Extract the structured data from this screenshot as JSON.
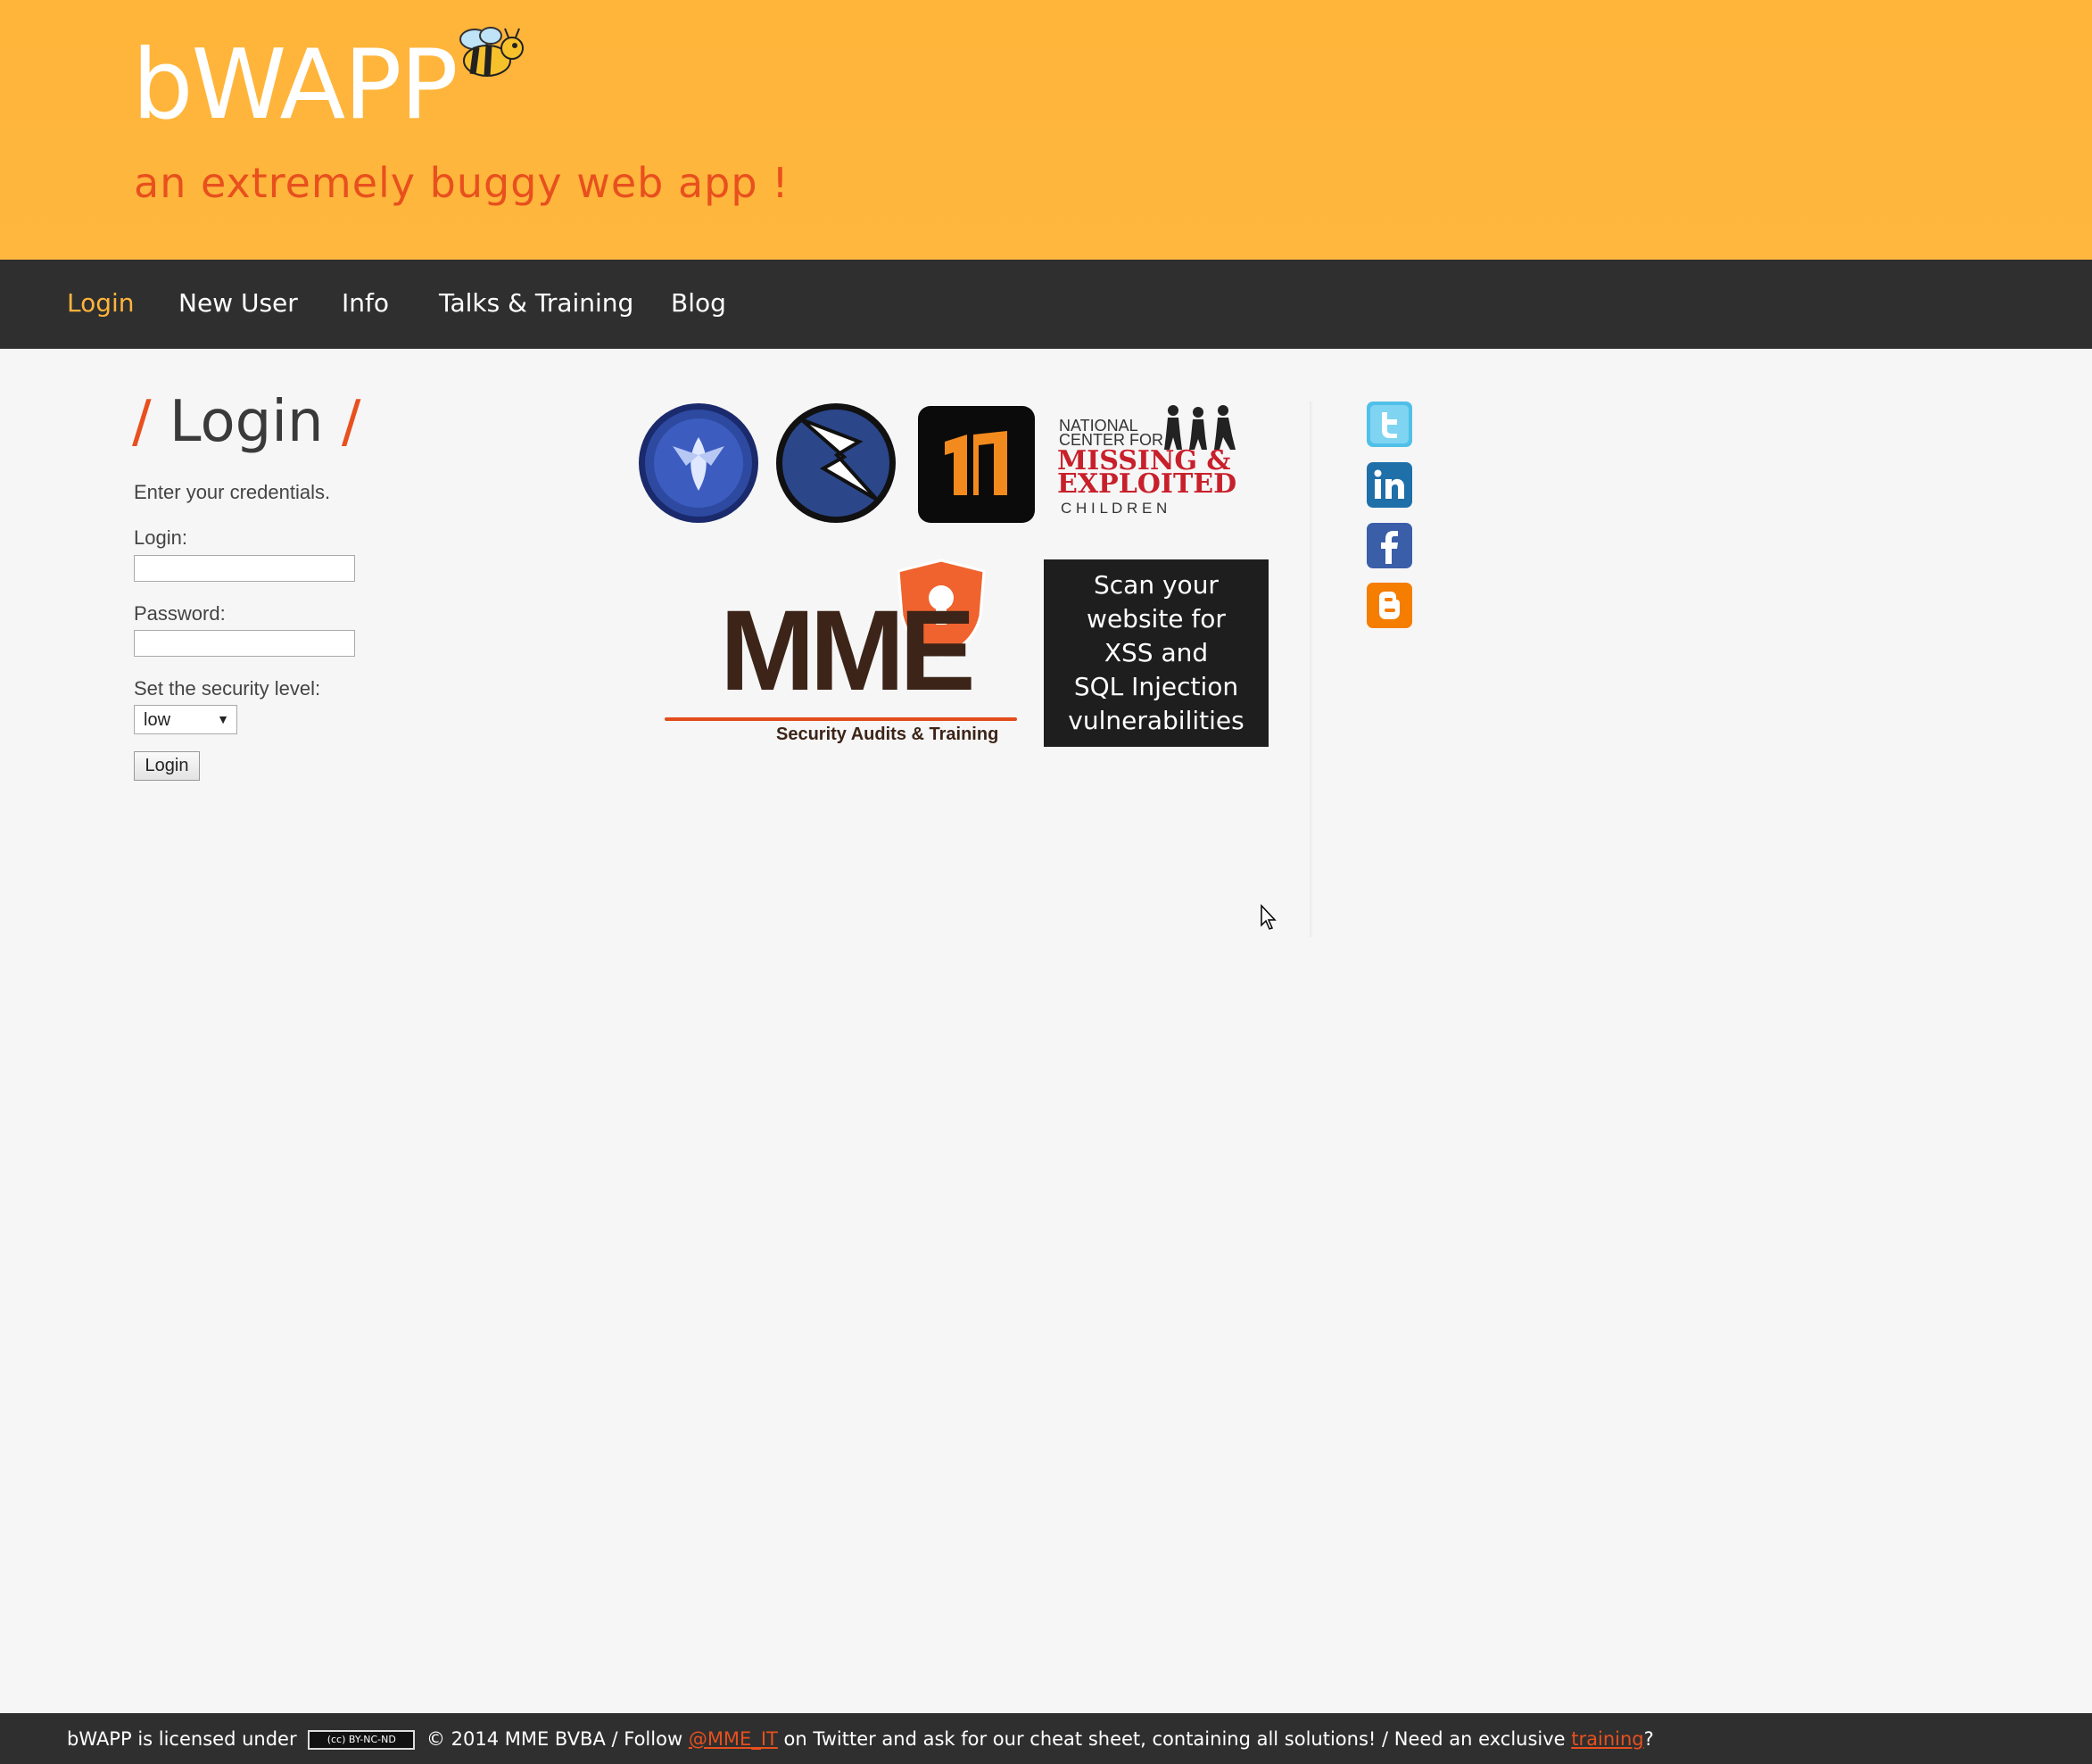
{
  "header": {
    "title": "bWAPP",
    "tagline": "an extremely buggy web app !"
  },
  "nav": {
    "items": [
      {
        "label": "Login",
        "active": true
      },
      {
        "label": "New User"
      },
      {
        "label": "Info"
      },
      {
        "label": "Talks & Training"
      },
      {
        "label": "Blog"
      }
    ]
  },
  "main": {
    "title_slash": "/",
    "title": "Login",
    "intro": "Enter your credentials.",
    "login_label": "Login:",
    "login_value": "",
    "password_label": "Password:",
    "password_value": "",
    "security_label": "Set the security level:",
    "security_value": "low",
    "submit_label": "Login"
  },
  "sponsors": {
    "ncmec_line1": "NATIONAL",
    "ncmec_line2": "CENTER FOR",
    "ncmec_line3": "MISSING &",
    "ncmec_line4": "EXPLOITED",
    "ncmec_line5": "C H I L D R E N",
    "mme_logo": "MME",
    "mme_sub": "Security Audits & Training",
    "scan_ad_lines": [
      "Scan your",
      "website for",
      "XSS and",
      "SQL Injection",
      "vulnerabilities"
    ]
  },
  "social": [
    "twitter-icon",
    "linkedin-icon",
    "facebook-icon",
    "blogger-icon"
  ],
  "footer": {
    "prefix": "bWAPP is licensed under",
    "cc_badge": "(cc) BY-NC-ND",
    "middle": "© 2014 MME BVBA / Follow",
    "twitter_handle": "@MME_IT",
    "after_handle": "on Twitter and ask for our cheat sheet, containing all solutions! / Need an exclusive",
    "training_link": "training",
    "suffix": "?"
  },
  "colors": {
    "header_bg": "#ffb43a",
    "accent_orange": "#e8501e",
    "nav_active": "#ffb33b",
    "nav_bg": "#2f2f2f"
  }
}
